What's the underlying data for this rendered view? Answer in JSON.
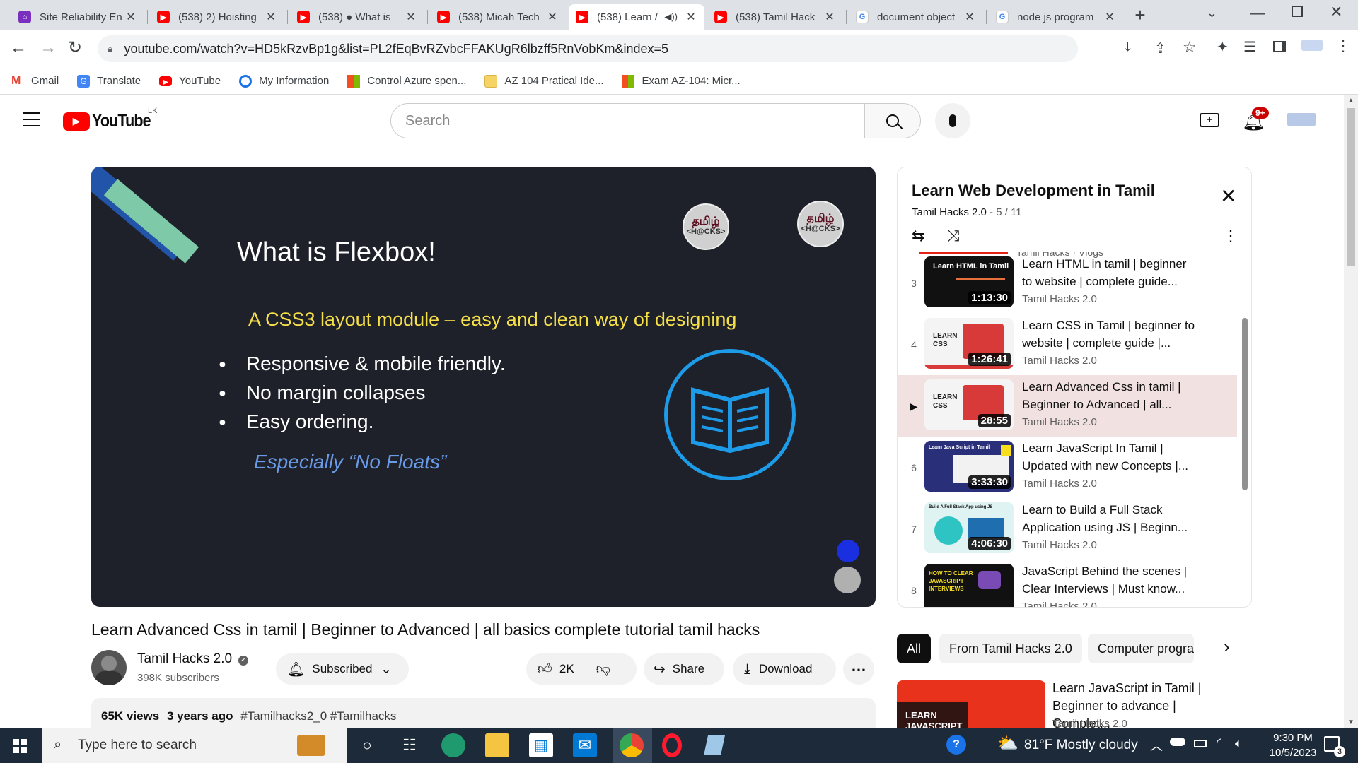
{
  "browser": {
    "tabs": [
      {
        "title": "Site Reliability En",
        "icon": "site-reliability-favicon",
        "active": false
      },
      {
        "title": "(538) 2) Hoisting",
        "icon": "youtube-favicon",
        "active": false
      },
      {
        "title": "(538) ● What is",
        "icon": "youtube-favicon",
        "active": false
      },
      {
        "title": "(538) Micah Tech",
        "icon": "youtube-favicon",
        "active": false
      },
      {
        "title": "(538) Learn /",
        "icon": "youtube-favicon",
        "active": true
      },
      {
        "title": "(538) Tamil Hack",
        "icon": "youtube-favicon",
        "active": false
      },
      {
        "title": "document object",
        "icon": "google-favicon",
        "active": false
      },
      {
        "title": "node js program",
        "icon": "google-favicon",
        "active": false
      }
    ],
    "url": "youtube.com/watch?v=HD5kRzvBp1g&list=PL2fEqBvRZvbcFFAKUgR6lbzff5RnVobKm&index=5",
    "bookmarks": [
      {
        "label": "Gmail",
        "icon": "gmail-icon",
        "color": "#ea4335"
      },
      {
        "label": "Translate",
        "icon": "translate-icon",
        "color": "#4285f4"
      },
      {
        "label": "YouTube",
        "icon": "youtube-icon",
        "color": "#ff0000"
      },
      {
        "label": "My Information",
        "icon": "info-icon",
        "color": "#1a73e8"
      },
      {
        "label": "Control Azure spen...",
        "icon": "microsoft-icon",
        "color": "#f25022"
      },
      {
        "label": "AZ 104 Pratical Ide...",
        "icon": "folder-icon",
        "color": "#f6d365"
      },
      {
        "label": "Exam AZ-104: Micr...",
        "icon": "microsoft-icon",
        "color": "#f25022"
      }
    ]
  },
  "youtube": {
    "logo_text": "YouTube",
    "country": "LK",
    "search_placeholder": "Search",
    "notification_count": "9+",
    "accent": "#ff0000"
  },
  "video": {
    "slide": {
      "title": "What is Flexbox!",
      "subtitle": "A CSS3 layout module – easy and clean way of designing",
      "bullets": [
        "Responsive & mobile friendly.",
        "No margin collapses",
        "Easy ordering."
      ],
      "note": "Especially “No Floats”",
      "badge_text": "தமிழ்",
      "badge_sub": "<H@CKS>"
    },
    "title": "Learn Advanced Css in tamil | Beginner to Advanced | all basics complete tutorial tamil hacks",
    "channel": "Tamil Hacks 2.0",
    "subscribers": "398K subscribers",
    "subscribed_label": "Subscribed",
    "likes": "2K",
    "share_label": "Share",
    "download_label": "Download",
    "views": "65K views",
    "age": "3 years ago",
    "hashtags": "#Tamilhacks2_0 #Tamilhacks"
  },
  "playlist": {
    "title": "Learn Web Development in Tamil",
    "channel": "Tamil Hacks 2.0",
    "position": "5 / 11",
    "partial_top": "Tamil Hacks · Vlogs",
    "items": [
      {
        "index": "3",
        "title": "Learn HTML in tamil | beginner to website | complete guide...",
        "channel": "Tamil Hacks 2.0",
        "duration": "1:13:30",
        "thumb_label": "Learn HTML in Tamil",
        "current": false
      },
      {
        "index": "4",
        "title": "Learn CSS in Tamil | beginner to website | complete guide |...",
        "channel": "Tamil Hacks 2.0",
        "duration": "1:26:41",
        "thumb_label": "LEARN CSS",
        "current": false
      },
      {
        "index": "▶",
        "title": "Learn Advanced Css in tamil | Beginner to Advanced | all...",
        "channel": "Tamil Hacks 2.0",
        "duration": "28:55",
        "thumb_label": "LEARN CSS",
        "current": true
      },
      {
        "index": "6",
        "title": "Learn JavaScript In Tamil | Updated with new Concepts |...",
        "channel": "Tamil Hacks 2.0",
        "duration": "3:33:30",
        "thumb_label": "Learn Java Script in Tamil",
        "current": false
      },
      {
        "index": "7",
        "title": "Learn to Build a Full Stack Application using JS | Beginn...",
        "channel": "Tamil Hacks 2.0",
        "duration": "4:06:30",
        "thumb_label": "Build A Full Stack App using JS",
        "current": false
      },
      {
        "index": "8",
        "title": "JavaScript Behind the scenes | Clear Interviews | Must know...",
        "channel": "Tamil Hacks 2.0",
        "duration": "",
        "thumb_label": "HOW TO CLEAR JAVASCRIPT INTERVIEWS",
        "current": false
      }
    ]
  },
  "chips": [
    "All",
    "From Tamil Hacks 2.0",
    "Computer programm"
  ],
  "recommended": {
    "title": "Learn JavaScript in Tamil | Beginner to advance | Complet...",
    "channel": "Tamil Hacks 2.0",
    "thumb_text": "LEARN JAVASCRIPT"
  },
  "taskbar": {
    "search_placeholder": "Type here to search",
    "weather": "81°F  Mostly cloudy",
    "time": "9:30 PM",
    "date": "10/5/2023",
    "notifications": "3"
  }
}
